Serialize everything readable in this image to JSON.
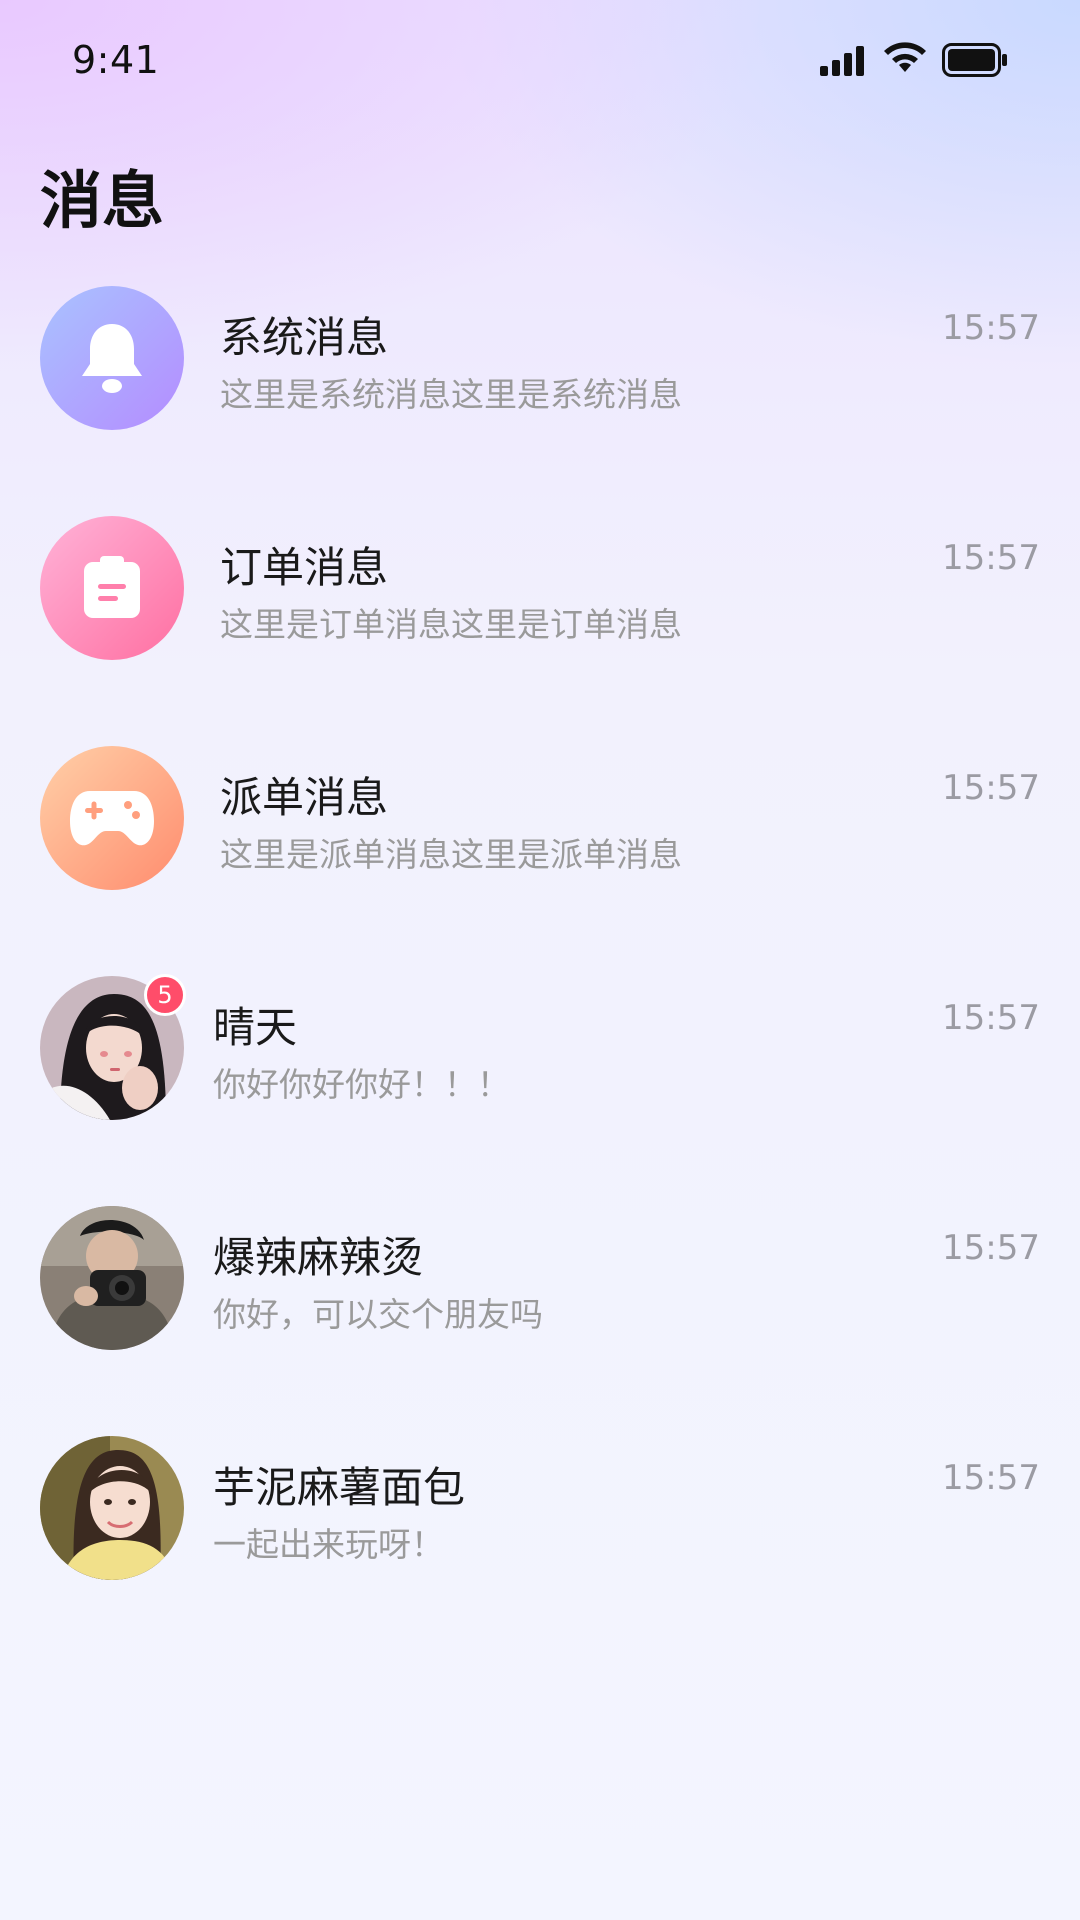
{
  "status_bar": {
    "time": "9:41",
    "icons": [
      "signal-icon",
      "wifi-icon",
      "battery-icon"
    ]
  },
  "page": {
    "title": "消息"
  },
  "colors": {
    "badge": "#ff4d6a",
    "system_avatar": [
      "#a9c3ff",
      "#b48cff"
    ],
    "order_avatar": [
      "#ffb3d8",
      "#ff6fa1"
    ],
    "dispatch_avatar": [
      "#ffd0a8",
      "#ff8c6e"
    ]
  },
  "messages": [
    {
      "name": "系统消息",
      "preview": "这里是系统消息这里是系统消息",
      "time": "15:57",
      "icon": "bell-icon"
    },
    {
      "name": "订单消息",
      "preview": "这里是订单消息这里是订单消息",
      "time": "15:57",
      "icon": "clipboard-icon"
    },
    {
      "name": "派单消息",
      "preview": "这里是派单消息这里是派单消息",
      "time": "15:57",
      "icon": "gamepad-icon"
    },
    {
      "name": "晴天",
      "preview": "你好你好你好！！！",
      "time": "15:57",
      "badge": "5",
      "icon": "user-avatar"
    },
    {
      "name": "爆辣麻辣烫",
      "preview": "你好，可以交个朋友吗",
      "time": "15:57",
      "icon": "user-avatar"
    },
    {
      "name": "芋泥麻薯面包",
      "preview": "一起出来玩呀！",
      "time": "15:57",
      "icon": "user-avatar"
    }
  ]
}
